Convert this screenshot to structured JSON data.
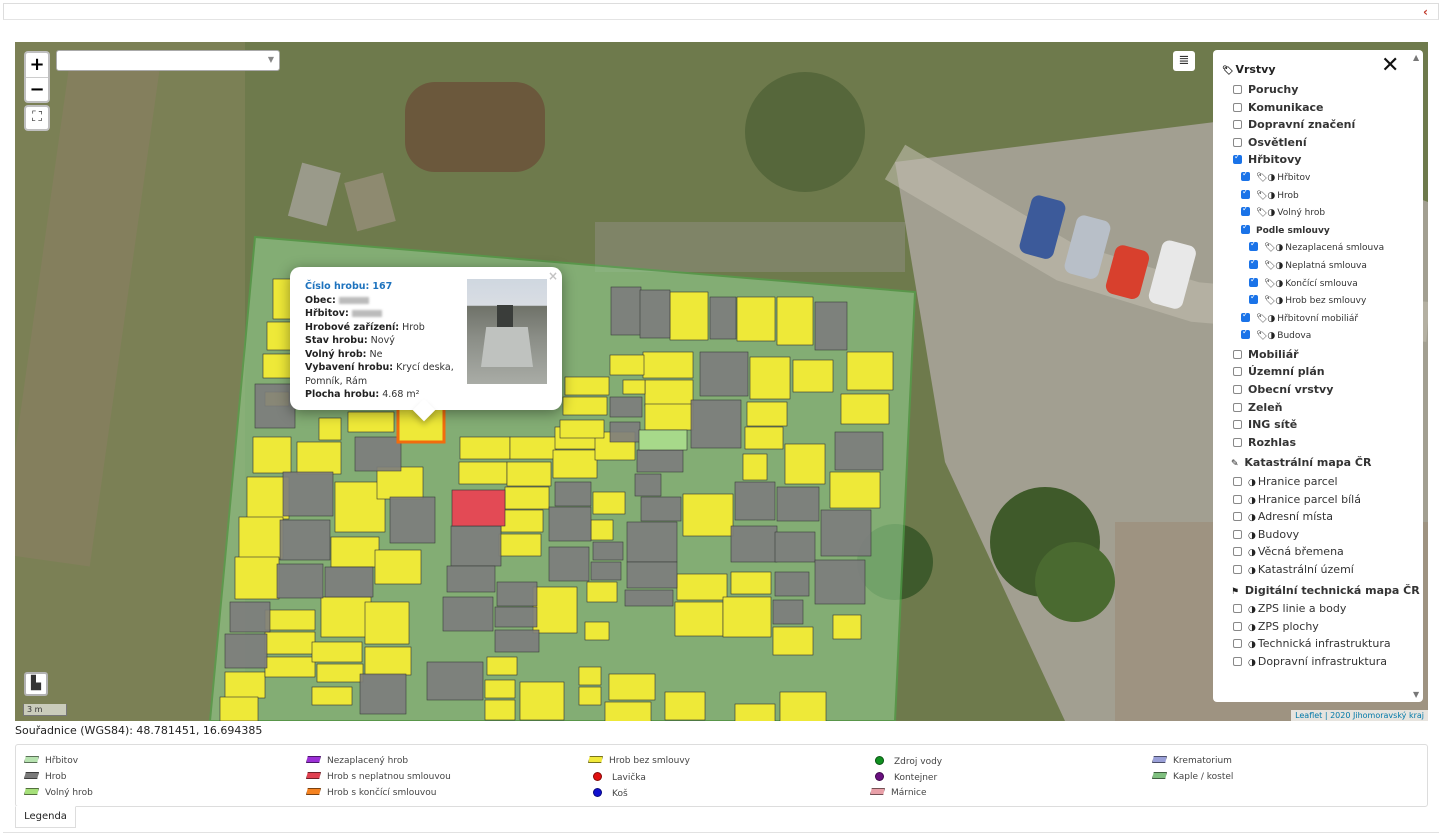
{
  "map": {
    "zoom_in": "+",
    "zoom_out": "−",
    "fullscreen_icon": "⛶",
    "layers_icon": "≣",
    "search_value": "",
    "scale": "3 m",
    "attribution_link": "Leaflet",
    "attribution_text": " | 2020 Jihomoravský kraj"
  },
  "popup": {
    "close": "×",
    "fields": [
      {
        "label": "Číslo hrobu:",
        "value": "167"
      },
      {
        "label": "Obec:",
        "value": "",
        "redacted": true
      },
      {
        "label": "Hřbitov:",
        "value": "",
        "redacted": true
      },
      {
        "label": "Hrobové zařízení:",
        "value": "Hrob"
      },
      {
        "label": "Stav hrobu:",
        "value": "Nový"
      },
      {
        "label": "Volný hrob:",
        "value": "Ne"
      },
      {
        "label": "Vybavení hrobu:",
        "value": "Krycí deska,"
      },
      {
        "label": "",
        "value": "Pomník, Rám"
      },
      {
        "label": "Plocha hrobu:",
        "value": "4.68 m²"
      }
    ]
  },
  "panel": {
    "title": "Vrstvy",
    "close": "✕",
    "layers": [
      {
        "label": "Poruchy",
        "checked": false
      },
      {
        "label": "Komunikace",
        "checked": false
      },
      {
        "label": "Dopravní značení",
        "checked": false
      },
      {
        "label": "Osvětlení",
        "checked": false
      },
      {
        "label": "Hřbitovy",
        "checked": true
      }
    ],
    "cemetery_sublayers": [
      {
        "label": "Hřbitov",
        "checked": true
      },
      {
        "label": "Hrob",
        "checked": true
      },
      {
        "label": "Volný hrob",
        "checked": true
      }
    ],
    "contract_group": {
      "label": "Podle smlouvy",
      "checked": true
    },
    "contract_sublayers": [
      {
        "label": "Nezaplacená smlouva",
        "checked": true
      },
      {
        "label": "Neplatná smlouva",
        "checked": true
      },
      {
        "label": "Končící smlouva",
        "checked": true
      },
      {
        "label": "Hrob bez smlouvy",
        "checked": true
      }
    ],
    "cemetery_sublayers_2": [
      {
        "label": "Hřbitovní mobiliář",
        "checked": true
      },
      {
        "label": "Budova",
        "checked": true
      }
    ],
    "layers_2": [
      {
        "label": "Mobiliář",
        "checked": false
      },
      {
        "label": "Územní plán",
        "checked": false
      },
      {
        "label": "Obecní vrstvy",
        "checked": false
      },
      {
        "label": "Zeleň",
        "checked": false
      },
      {
        "label": "ING sítě",
        "checked": false
      },
      {
        "label": "Rozhlas",
        "checked": false
      }
    ],
    "cadastre_title": "Katastrální mapa ČR",
    "cadastre_layers": [
      {
        "label": "Hranice parcel"
      },
      {
        "label": "Hranice parcel bílá"
      },
      {
        "label": "Adresní místa"
      },
      {
        "label": "Budovy"
      },
      {
        "label": "Věcná břemena"
      },
      {
        "label": "Katastrální území"
      }
    ],
    "dtm_title": "Digitální technická mapa ČR",
    "dtm_layers": [
      {
        "label": "ZPS linie a body"
      },
      {
        "label": "ZPS plochy"
      },
      {
        "label": "Technická infrastruktura"
      },
      {
        "label": "Dopravní infrastruktura"
      }
    ]
  },
  "coordinates": "Souřadnice (WGS84): 48.781451, 16.694385",
  "legend": {
    "tab_label": "Legenda",
    "items": [
      {
        "label": "Hřbitov",
        "kind": "swatch",
        "color": "#b7e3b0"
      },
      {
        "label": "Hrob",
        "kind": "swatch",
        "color": "#7a7a7a"
      },
      {
        "label": "Volný hrob",
        "kind": "swatch",
        "color": "#a6e07a"
      },
      {
        "label": "Nezaplacený hrob",
        "kind": "swatch",
        "color": "#9b2fd6"
      },
      {
        "label": "Hrob s neplatnou smlouvou",
        "kind": "swatch",
        "color": "#e04050"
      },
      {
        "label": "Hrob s končící smlouvou",
        "kind": "swatch",
        "color": "#f58220"
      },
      {
        "label": "Hrob bez smlouvy",
        "kind": "swatch",
        "color": "#f1e93a"
      },
      {
        "label": "Lavička",
        "kind": "dot",
        "color": "#e01010"
      },
      {
        "label": "Koš",
        "kind": "dot",
        "color": "#1010d0"
      },
      {
        "label": "Zdroj vody",
        "kind": "dot",
        "color": "#109020"
      },
      {
        "label": "Kontejner",
        "kind": "dot",
        "color": "#6a1080"
      },
      {
        "label": "Márnice",
        "kind": "swatch",
        "color": "#e8a0a8"
      },
      {
        "label": "Krematorium",
        "kind": "swatch",
        "color": "#9aa0d8"
      },
      {
        "label": "Kaple / kostel",
        "kind": "swatch",
        "color": "#7fbf7f"
      }
    ]
  },
  "colors": {
    "grave_yellow": "#eee938",
    "grave_gray": "#808080",
    "grave_red": "#e34a55",
    "grave_green": "#a7d98a",
    "selected_orange": "#f26c0d",
    "cemetery_fill": "#8fc98a"
  }
}
